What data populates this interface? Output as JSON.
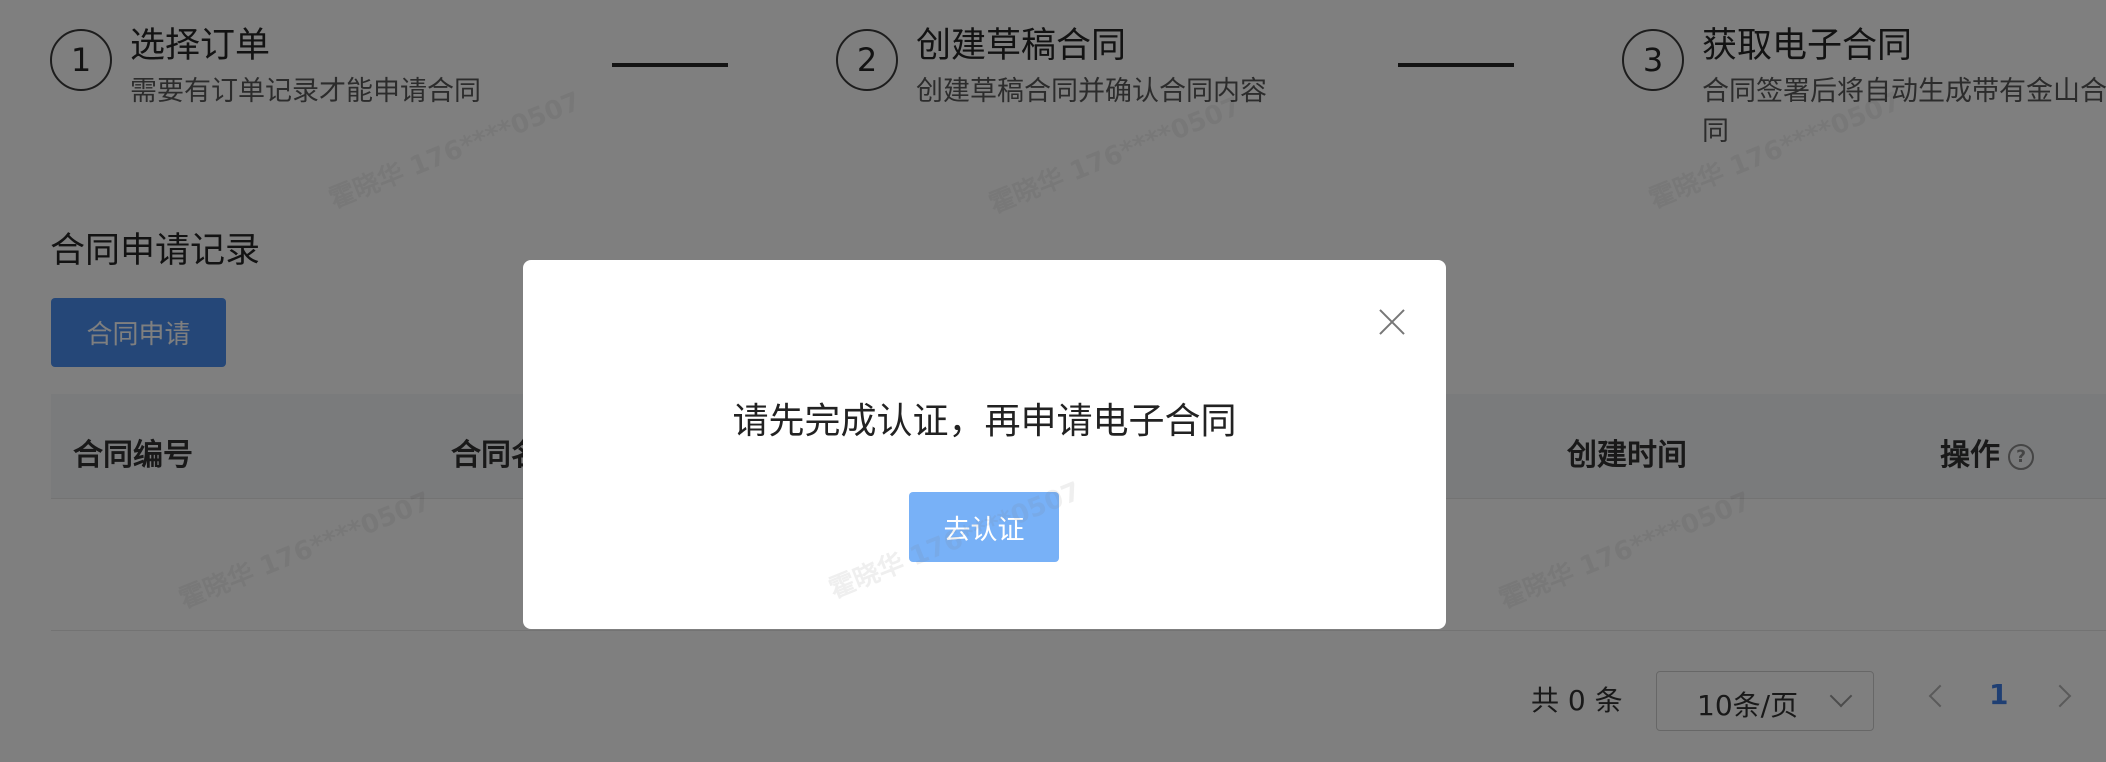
{
  "steps": [
    {
      "number": "1",
      "title": "选择订单",
      "desc": "需要有订单记录才能申请合同"
    },
    {
      "number": "2",
      "title": "创建草稿合同",
      "desc": "创建草稿合同并确认合同内容"
    },
    {
      "number": "3",
      "title": "获取电子合同",
      "desc": "合同签署后将自动生成带有金山合同"
    }
  ],
  "section": {
    "title": "合同申请记录",
    "apply_button": "合同申请"
  },
  "table": {
    "columns": [
      "合同编号",
      "合同名",
      "创建时间",
      "操作"
    ],
    "help_icon_glyph": "?"
  },
  "pagination": {
    "total": "共 0 条",
    "page_size": "10条/页",
    "current_page": "1"
  },
  "modal": {
    "message": "请先完成认证，再申请电子合同",
    "button": "去认证"
  },
  "watermark": "霍晓华 176****0507",
  "icons": {
    "close": "close-icon",
    "help": "question-circle-icon",
    "prev": "chevron-left-icon",
    "next": "chevron-right-icon",
    "dropdown": "chevron-down-icon"
  },
  "colors": {
    "primary": "#4a8ff0",
    "modal_button": "#78b1f7",
    "active_page": "#3f7fe6"
  }
}
